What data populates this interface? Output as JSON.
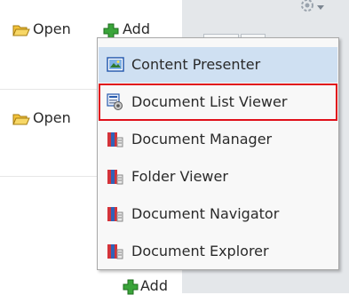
{
  "left_rows": [
    {
      "open_label": "Open",
      "add_label": "Add"
    },
    {
      "open_label": "Open"
    },
    {
      "add_label": "Add"
    }
  ],
  "menu": {
    "items": [
      {
        "label": "Content Presenter",
        "icon": "content-presenter-icon",
        "state": "hover"
      },
      {
        "label": "Document List Viewer",
        "icon": "document-list-viewer-icon",
        "state": "highlighted"
      },
      {
        "label": "Document Manager",
        "icon": "document-manager-icon"
      },
      {
        "label": "Folder Viewer",
        "icon": "folder-viewer-icon"
      },
      {
        "label": "Document Navigator",
        "icon": "document-navigator-icon"
      },
      {
        "label": "Document Explorer",
        "icon": "document-explorer-icon"
      }
    ]
  },
  "colors": {
    "highlight_border": "#e0101a",
    "hover_bg": "#cfe0f2",
    "panel_bg": "#e4e7ea"
  }
}
